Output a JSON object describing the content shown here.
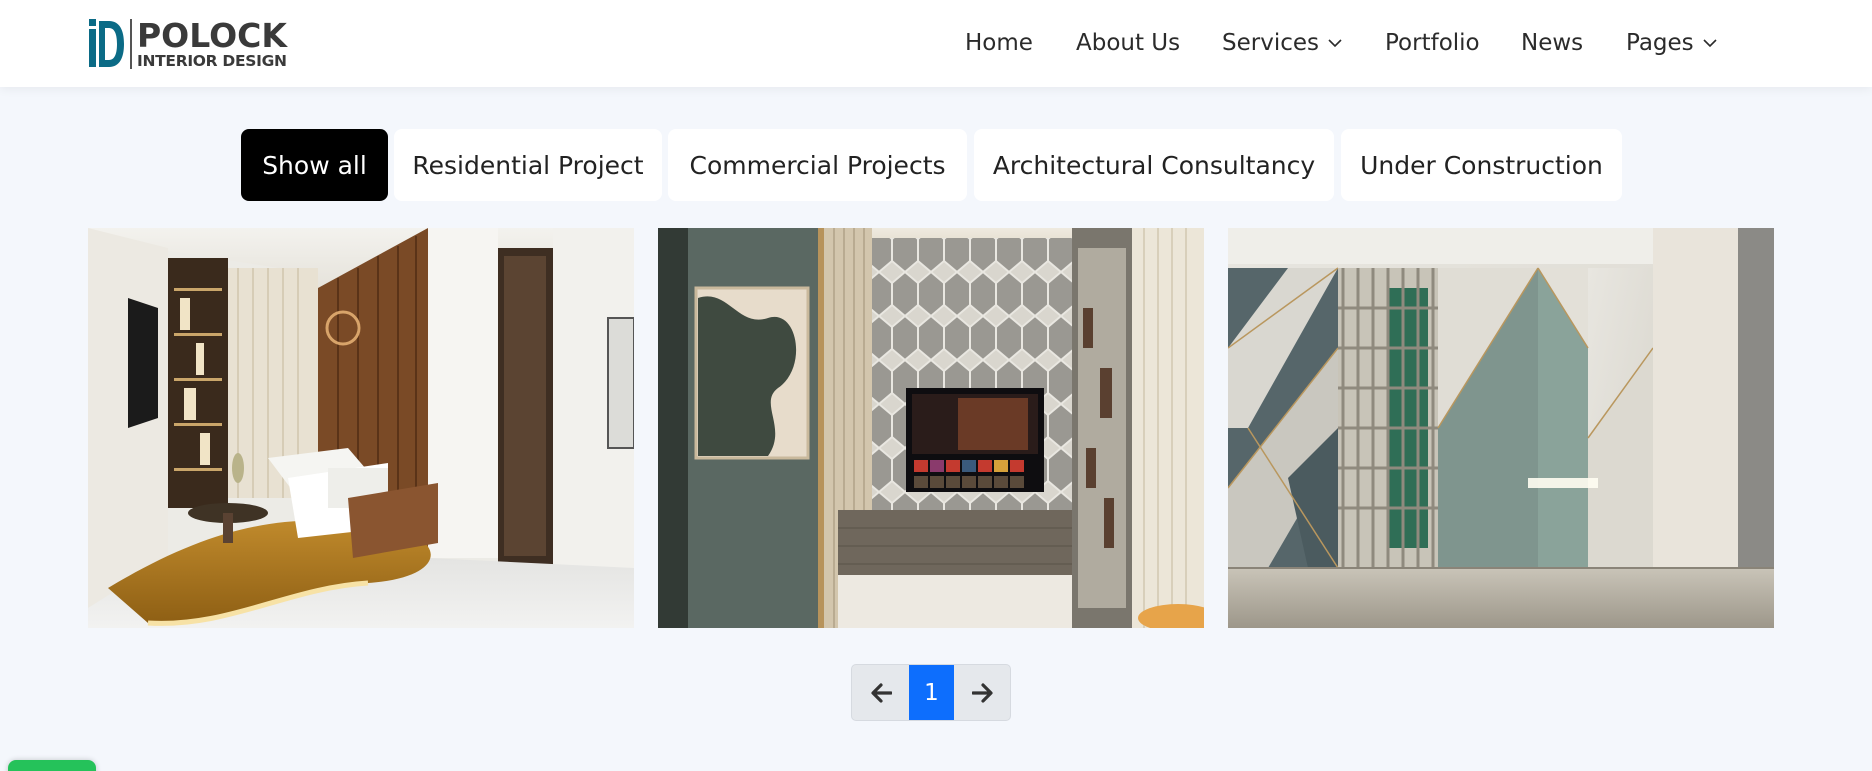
{
  "brand": {
    "logo_initials": "iD",
    "name": "POLOCK",
    "tagline": "INTERIOR DESIGN",
    "accent_color": "#0b6b86"
  },
  "nav": {
    "home": "Home",
    "about": "About Us",
    "services": "Services",
    "portfolio": "Portfolio",
    "news": "News",
    "pages": "Pages"
  },
  "filters": {
    "show_all": "Show all",
    "residential": "Residential Project",
    "commercial": "Commercial Projects",
    "architectural": "Architectural Consultancy",
    "under_construction": "Under Construction",
    "active": "Show all"
  },
  "gallery": [
    {
      "id": "living-room",
      "description": "Living room interior with white sofa and wooden accent wall"
    },
    {
      "id": "tv-wall",
      "description": "TV feature wall with geometric metal screen"
    },
    {
      "id": "geometric-panels",
      "description": "Geometric green and marble wall panels"
    }
  ],
  "pagination": {
    "current_page": "1",
    "prev_icon": "arrow-left-icon",
    "next_icon": "arrow-right-icon",
    "active_color": "#0d6efd"
  },
  "colors": {
    "page_background": "#f4f7fc",
    "active_filter": "#000000",
    "chat_button": "#25c25a"
  }
}
